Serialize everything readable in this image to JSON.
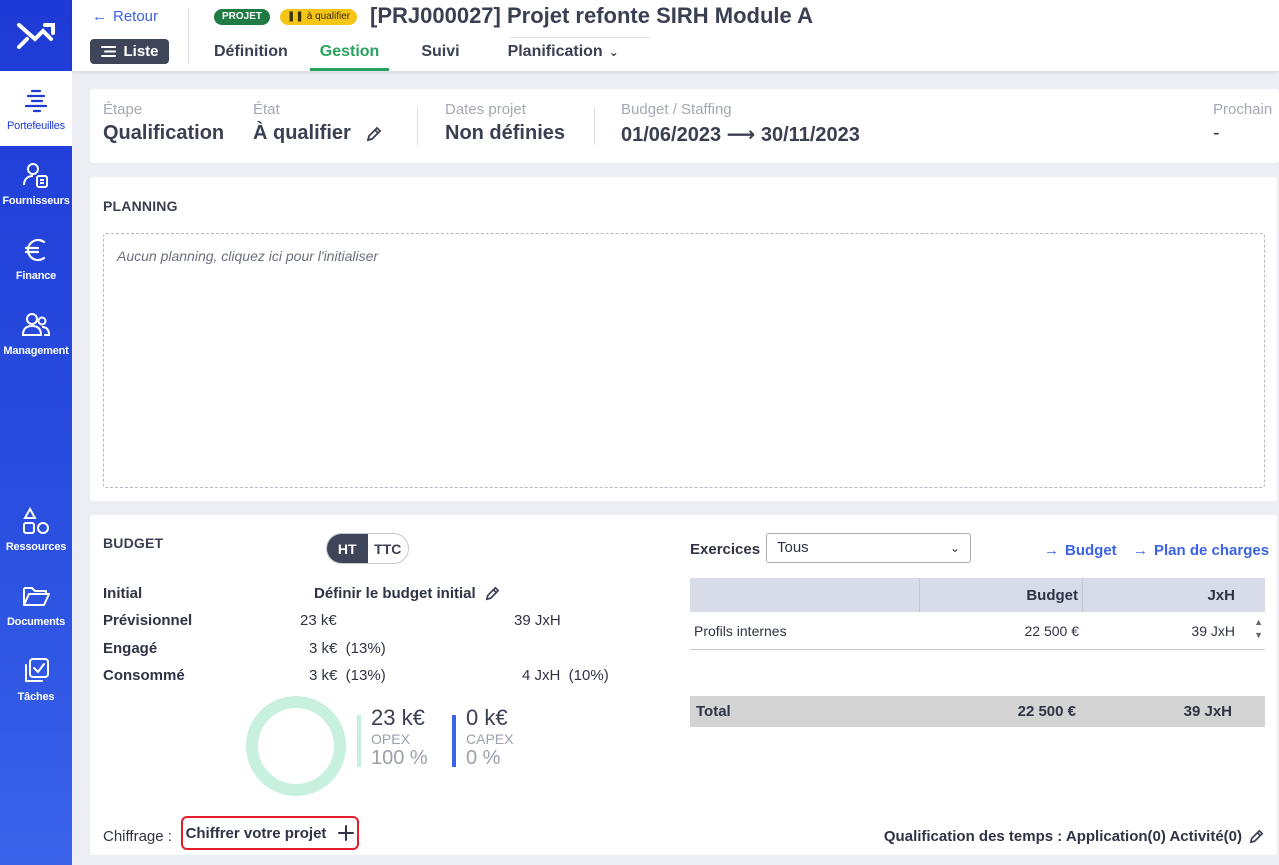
{
  "colors": {
    "sidebar": "#1e3ad6",
    "accent_green": "#27a35e",
    "link_blue": "#3b63e8",
    "badge_projet": "#1f7a43",
    "badge_qualifier": "#f5c518",
    "highlight_red": "#e21e2a"
  },
  "sidebar": {
    "items": [
      {
        "label": "Portefeuilles",
        "icon": "portfolio-icon",
        "active": true
      },
      {
        "label": "Fournisseurs",
        "icon": "supplier-icon"
      },
      {
        "label": "Finance",
        "icon": "euro-icon"
      },
      {
        "label": "Management",
        "icon": "people-icon"
      }
    ],
    "bottom_items": [
      {
        "label": "Ressources",
        "icon": "shapes-icon"
      },
      {
        "label": "Documents",
        "icon": "folder-icon"
      },
      {
        "label": "Tâches",
        "icon": "tasks-icon"
      }
    ]
  },
  "header": {
    "back_label": "Retour",
    "list_label": "Liste",
    "badge_type": "PROJET",
    "badge_status": "à qualifier",
    "title": "[PRJ000027] Projet refonte SIRH Module A",
    "tabs": [
      "Définition",
      "Gestion",
      "Suivi",
      "Planification"
    ],
    "active_tab": "Gestion"
  },
  "infobar": {
    "etape_label": "Étape",
    "etape_value": "Qualification",
    "etat_label": "État",
    "etat_value": "À qualifier",
    "dates_label": "Dates projet",
    "dates_value": "Non définies",
    "budget_label": "Budget / Staffing",
    "budget_value": "01/06/2023 ⟶ 30/11/2023",
    "prochain_label": "Prochain",
    "prochain_value": "-"
  },
  "planning": {
    "title": "PLANNING",
    "empty_text": "Aucun planning, cliquez ici pour l'initialiser"
  },
  "budget": {
    "title": "BUDGET",
    "toggle_ht": "HT",
    "toggle_ttc": "TTC",
    "rows": {
      "initial_label": "Initial",
      "initial_action": "Définir le budget initial",
      "previsionnel_label": "Prévisionnel",
      "previsionnel_amount": "23 k€",
      "previsionnel_jxh": "39 JxH",
      "engage_label": "Engagé",
      "engage_amount": "3 k€  (13%)",
      "consomme_label": "Consommé",
      "consomme_amount": "3 k€  (13%)",
      "consomme_jxh": "4 JxH  (10%)"
    },
    "opex": {
      "value": "23 k€",
      "label": "OPEX",
      "pct": "100 %",
      "fraction": 1.0,
      "color": "#c8f0de"
    },
    "capex": {
      "value": "0 k€",
      "label": "CAPEX",
      "pct": "0 %",
      "fraction": 0.0,
      "color": "#3b63e8"
    },
    "chiffrage_label": "Chiffrage :",
    "chiffrer_label": "Chiffrer votre projet",
    "qualification_label": "Qualification des temps : Application(0) Activité(0)",
    "exercices_label": "Exercices",
    "exercices_value": "Tous",
    "link_budget": "Budget",
    "link_plan": "Plan de charges",
    "table": {
      "headers": [
        "",
        "Budget",
        "JxH"
      ],
      "rows": [
        {
          "name": "Profils internes",
          "budget": "22 500 €",
          "jxh": "39 JxH"
        }
      ],
      "total": {
        "name": "Total",
        "budget": "22 500 €",
        "jxh": "39 JxH"
      }
    }
  }
}
